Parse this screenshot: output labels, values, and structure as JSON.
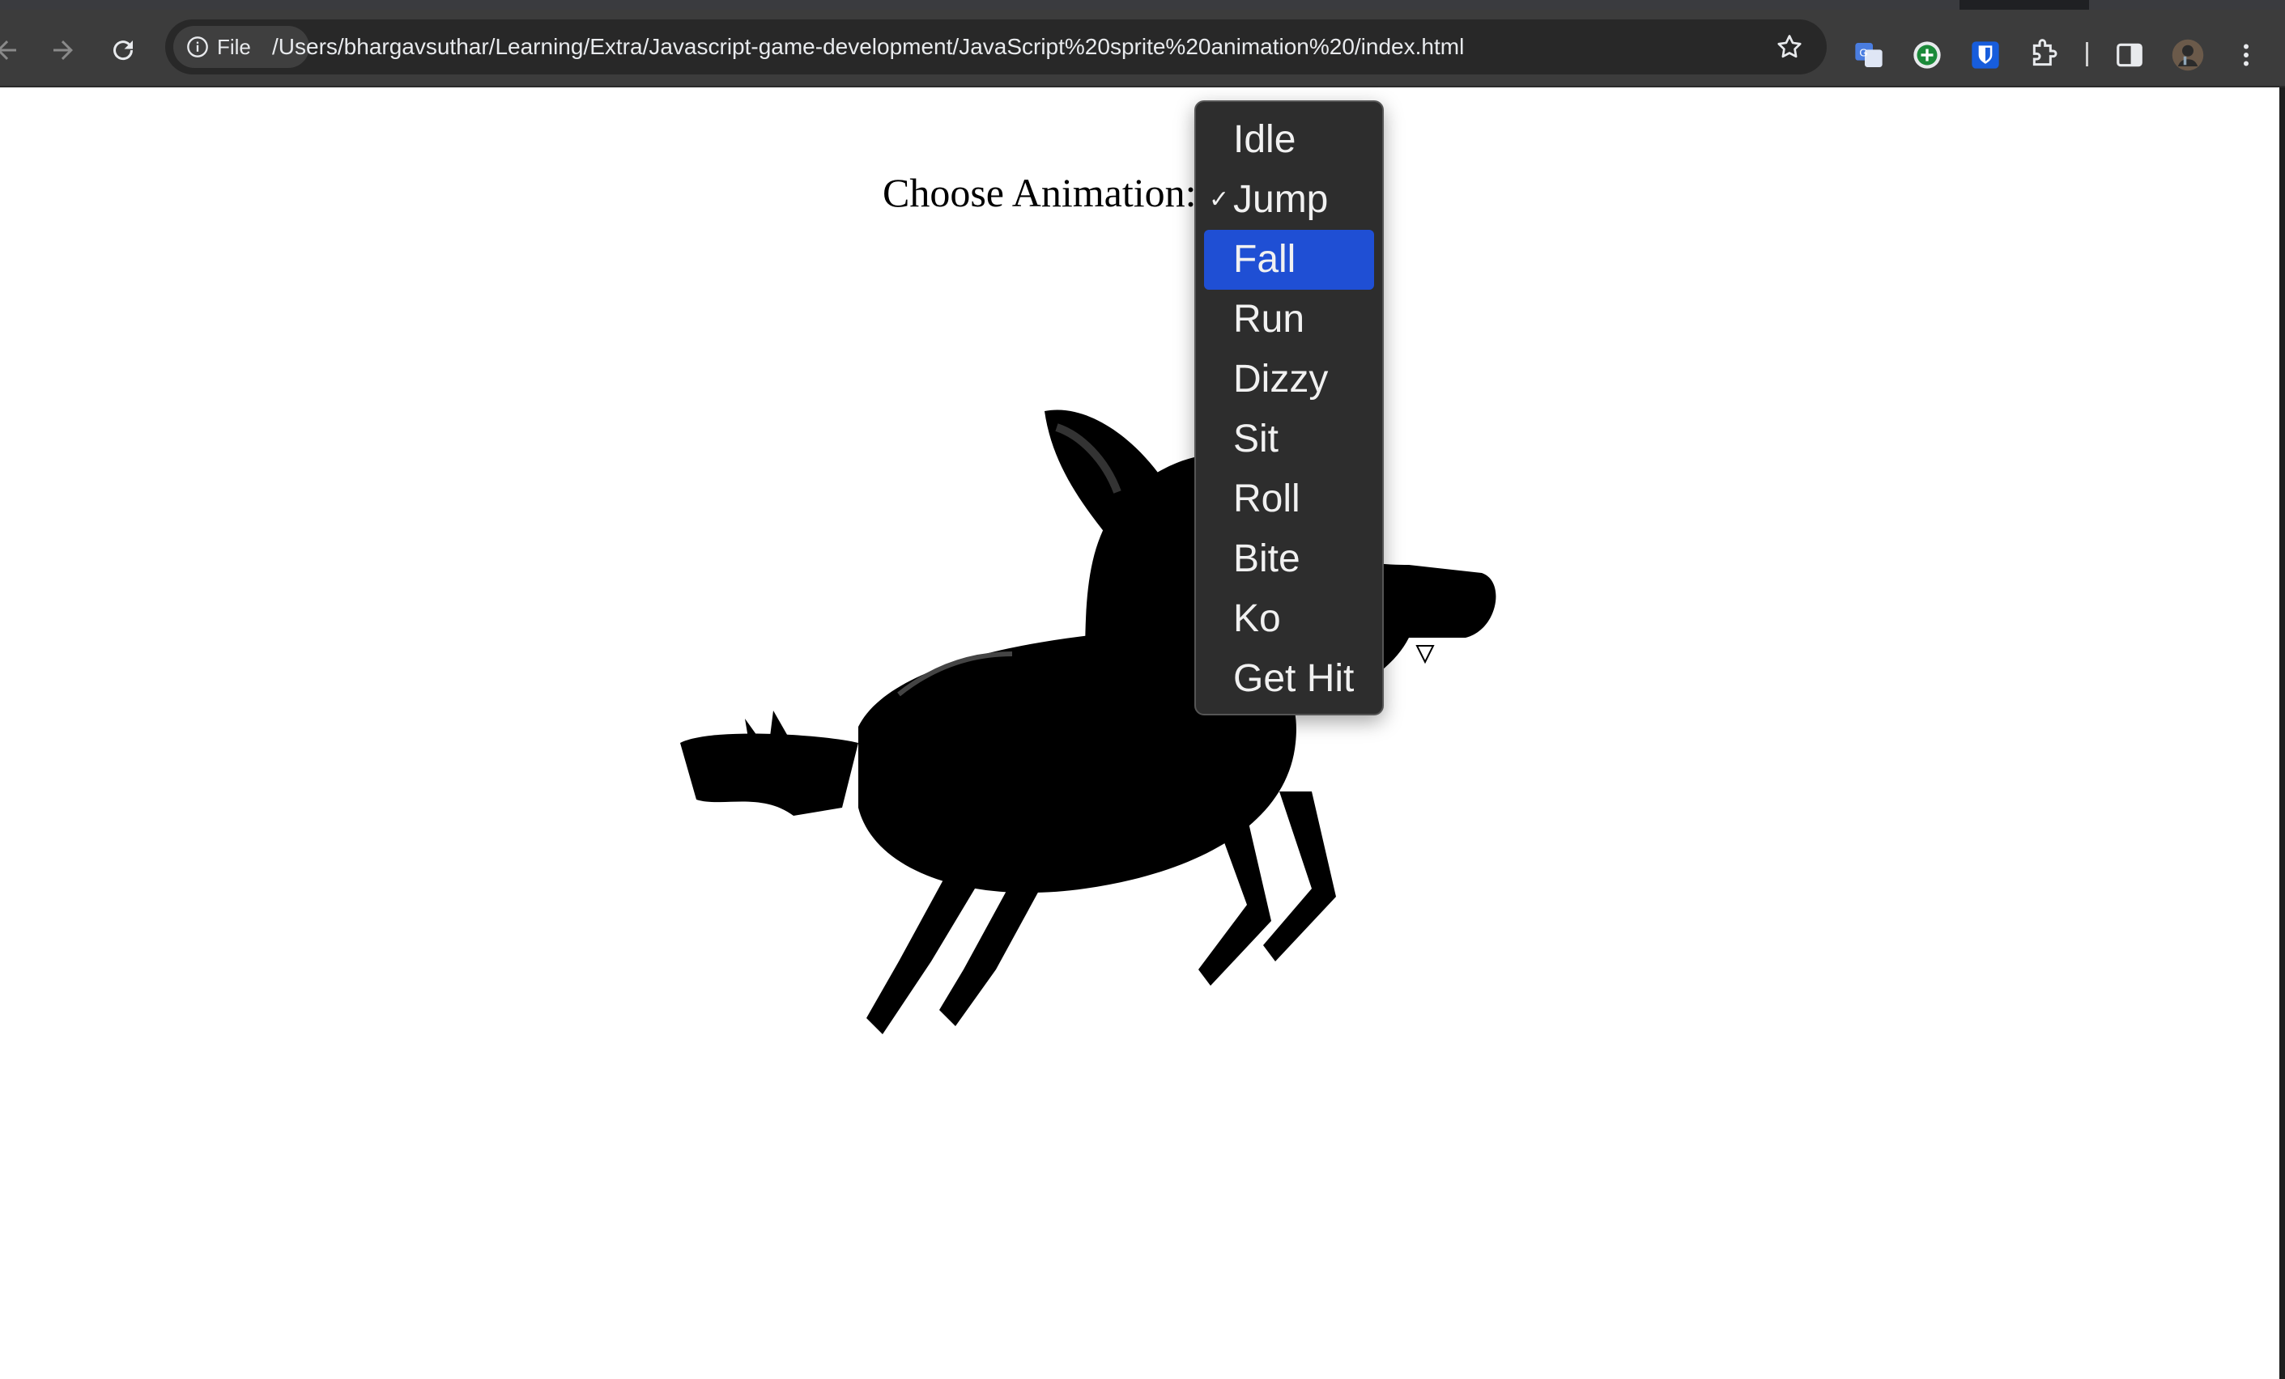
{
  "browser": {
    "url": "/Users/bhargavsuthar/Learning/Extra/Javascript-game-development/JavaScript%20sprite%20animation%20/index.html",
    "site_chip_label": "File",
    "icons": [
      "back-arrow-icon",
      "forward-arrow-icon",
      "reload-icon",
      "info-icon",
      "star-icon",
      "translate-icon",
      "add-extension-icon",
      "bitwarden-icon",
      "puzzle-icon",
      "side-panel-icon",
      "profile-avatar",
      "more-menu-icon"
    ]
  },
  "page": {
    "label": "Choose Animation:",
    "sprite": "shadow-dog-sprite"
  },
  "dropdown": {
    "selected": "Jump",
    "highlighted": "Fall",
    "options": [
      "Idle",
      "Jump",
      "Fall",
      "Run",
      "Dizzy",
      "Sit",
      "Roll",
      "Bite",
      "Ko",
      "Get Hit"
    ]
  },
  "colors": {
    "toolbar": "#3c3c3c",
    "omnibox": "#282828",
    "dropdown_bg": "#2d2d2d",
    "highlight": "#1f4fd4"
  }
}
